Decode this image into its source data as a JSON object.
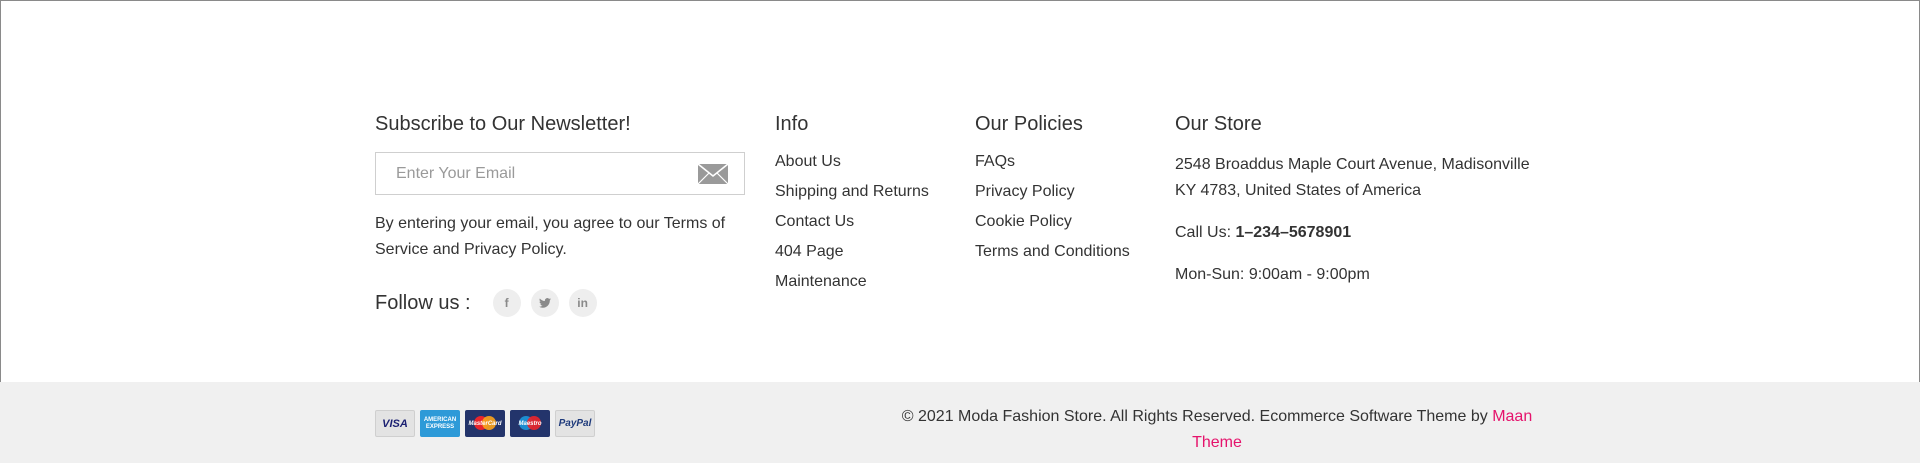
{
  "newsletter": {
    "title": "Subscribe to Our Newsletter!",
    "email_placeholder": "Enter Your Email",
    "send_icon": "envelope-icon",
    "agreement": "By entering your email, you agree to our Terms of Service and Privacy Policy.",
    "follow_label": "Follow us :",
    "social": [
      {
        "icon": "facebook-icon",
        "glyph": "f"
      },
      {
        "icon": "twitter-icon",
        "glyph": "t"
      },
      {
        "icon": "linkedin-icon",
        "glyph": "in"
      }
    ]
  },
  "info": {
    "title": "Info",
    "links": [
      "About Us",
      "Shipping and Returns",
      "Contact Us",
      "404 Page",
      "Maintenance"
    ]
  },
  "policies": {
    "title": "Our Policies",
    "links": [
      "FAQs",
      "Privacy Policy",
      "Cookie Policy",
      "Terms and Conditions"
    ]
  },
  "store": {
    "title": "Our Store",
    "address_line1": "2548 Broaddus Maple Court Avenue, Madisonville",
    "address_line2": "KY 4783, United States of America",
    "call_label": "Call Us:",
    "phone": "1–234–5678901",
    "hours": "Mon-Sun: 9:00am - 9:00pm"
  },
  "bottom": {
    "payments": [
      {
        "icon": "visa-icon",
        "label": "VISA"
      },
      {
        "icon": "american-express-icon",
        "label": "AMERICAN EXPRESS"
      },
      {
        "icon": "mastercard-icon",
        "label": "MasterCard"
      },
      {
        "icon": "maestro-icon",
        "label": "Maestro"
      },
      {
        "icon": "paypal-icon",
        "label": "PayPal"
      }
    ],
    "copyright_text": "© 2021 Moda Fashion Store. All Rights Reserved. Ecommerce Software Theme by ",
    "theme_link": "Maan Theme"
  },
  "colors": {
    "accent": "#e5136c",
    "bottom_bar": "#f0f0f0",
    "text": "#333333"
  }
}
